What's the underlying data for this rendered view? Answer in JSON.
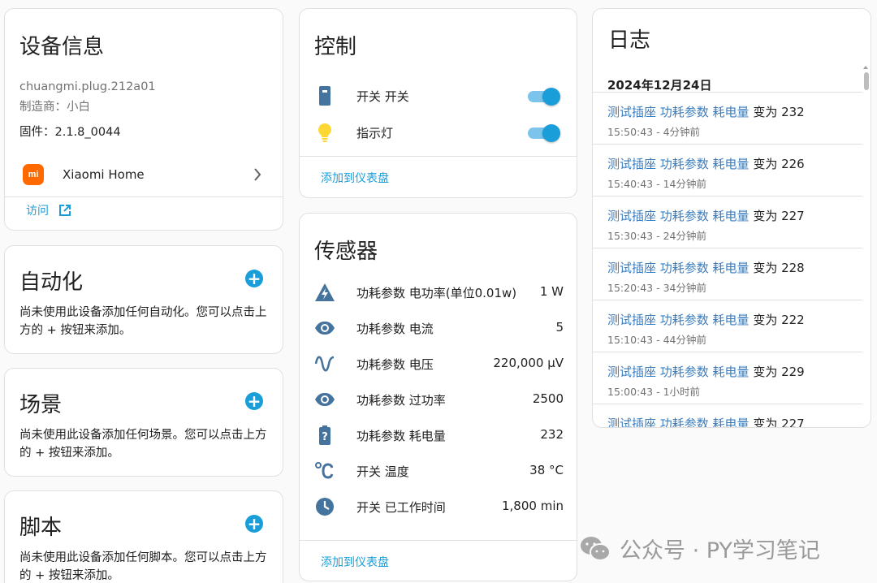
{
  "device_info": {
    "title": "设备信息",
    "model": "chuangmi.plug.212a01",
    "manufacturer": "制造商：小白",
    "firmware": "固件：2.1.8_0044",
    "integration_logo": "mi",
    "integration_name": "Xiaomi Home",
    "visit_label": "访问"
  },
  "automation": {
    "title": "自动化",
    "description": "尚未使用此设备添加任何自动化。您可以点击上方的 + 按钮来添加。"
  },
  "scene": {
    "title": "场景",
    "description": "尚未使用此设备添加任何场景。您可以点击上方的 + 按钮来添加。"
  },
  "script": {
    "title": "脚本",
    "description": "尚未使用此设备添加任何脚本。您可以点击上方的 + 按钮来添加。"
  },
  "control": {
    "title": "控制",
    "items": [
      {
        "label": "开关 开关",
        "icon": "power-socket-icon",
        "state": "on"
      },
      {
        "label": "指示灯",
        "icon": "lightbulb-icon",
        "state": "on"
      }
    ],
    "add_to_dashboard": "添加到仪表盘"
  },
  "sensors": {
    "title": "传感器",
    "items": [
      {
        "label": "功耗参数 电功率(单位0.01w)",
        "value": "1 W",
        "icon": "flash-triangle-icon"
      },
      {
        "label": "功耗参数 电流",
        "value": "5",
        "icon": "eye-icon"
      },
      {
        "label": "功耗参数 电压",
        "value": "220,000 μV",
        "icon": "sine-wave-icon"
      },
      {
        "label": "功耗参数 过功率",
        "value": "2500",
        "icon": "eye-icon"
      },
      {
        "label": "功耗参数 耗电量",
        "value": "232",
        "icon": "battery-unknown-icon"
      },
      {
        "label": "开关 温度",
        "value": "38 °C",
        "icon": "temperature-celsius-icon"
      },
      {
        "label": "开关 已工作时间",
        "value": "1,800 min",
        "icon": "clock-icon"
      }
    ],
    "add_to_dashboard": "添加到仪表盘"
  },
  "logbook": {
    "title": "日志",
    "date": "2024年12月24日",
    "entries": [
      {
        "entity": "测试插座 功耗参数 耗电量",
        "change": " 变为 232",
        "time": "15:50:43 - 4分钟前"
      },
      {
        "entity": "测试插座 功耗参数 耗电量",
        "change": " 变为 226",
        "time": "15:40:43 - 14分钟前"
      },
      {
        "entity": "测试插座 功耗参数 耗电量",
        "change": " 变为 227",
        "time": "15:30:43 - 24分钟前"
      },
      {
        "entity": "测试插座 功耗参数 耗电量",
        "change": " 变为 228",
        "time": "15:20:43 - 34分钟前"
      },
      {
        "entity": "测试插座 功耗参数 耗电量",
        "change": " 变为 222",
        "time": "15:10:43 - 44分钟前"
      },
      {
        "entity": "测试插座 功耗参数 耗电量",
        "change": " 变为 229",
        "time": "15:00:43 - 1小时前"
      },
      {
        "entity": "测试插座 功耗参数 耗电量",
        "change": " 变为 227",
        "time": ""
      }
    ]
  },
  "watermark": "公众号 · PY学习笔记",
  "colors": {
    "accent": "#1a9ed9",
    "icon": "#44739e",
    "bulb": "#fdd835",
    "mi_brand": "#ff6900",
    "text": "#212121",
    "muted": "#727272"
  }
}
